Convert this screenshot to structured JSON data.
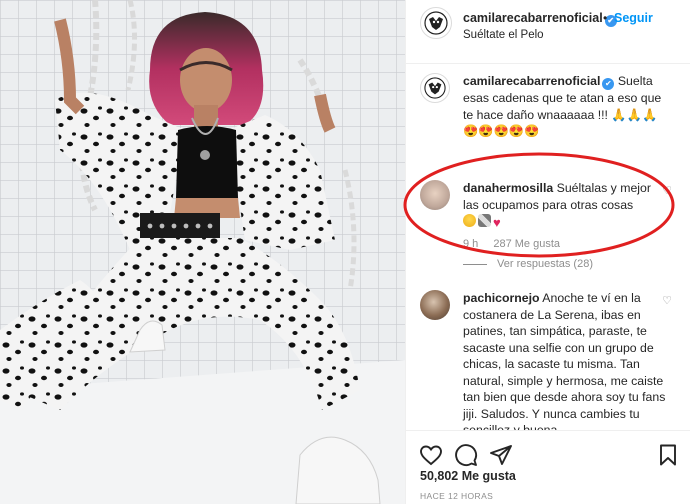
{
  "post": {
    "author": "camilarecabarrenoficial",
    "verified_glyph": "✔",
    "separator": "•",
    "follow_label": "Seguir",
    "location": "Suéltate el Pelo"
  },
  "caption": {
    "author": "camilarecabarrenoficial",
    "text": "Suelta esas cadenas que te atan a eso que te hace daño wnaaaaaa !!! 🙏🙏🙏😍😍😍😍😍"
  },
  "comments": [
    {
      "user": "danahermosilla",
      "text": "Suéltalas y mejor las ocupamos para otras cosas",
      "time": "9 h",
      "likes": "287 Me gusta",
      "replies": "Ver respuestas (28)"
    },
    {
      "user": "pachicornejo",
      "text": "Anoche te ví en la costanera de La Serena, ibas en patines, tan simpática, paraste, te sacaste una selfie con un grupo de chicas, la sacaste tu misma. Tan natural, simple y hermosa, me caiste tan bien que desde ahora soy tu fans jiji. Saludos. Y nunca cambies tu sencillez y buena"
    }
  ],
  "footer": {
    "likes": "50,802 Me gusta",
    "ago": "HACE 12 HORAS"
  },
  "icons": [
    "logo-avatar-icon",
    "verified-icon",
    "heart-icon",
    "comment-icon",
    "share-icon",
    "bookmark-icon"
  ],
  "colors": {
    "accent": "#0095f6",
    "verified": "#3897f0",
    "annotation": "#e02020",
    "muted": "#8e8e8e"
  }
}
